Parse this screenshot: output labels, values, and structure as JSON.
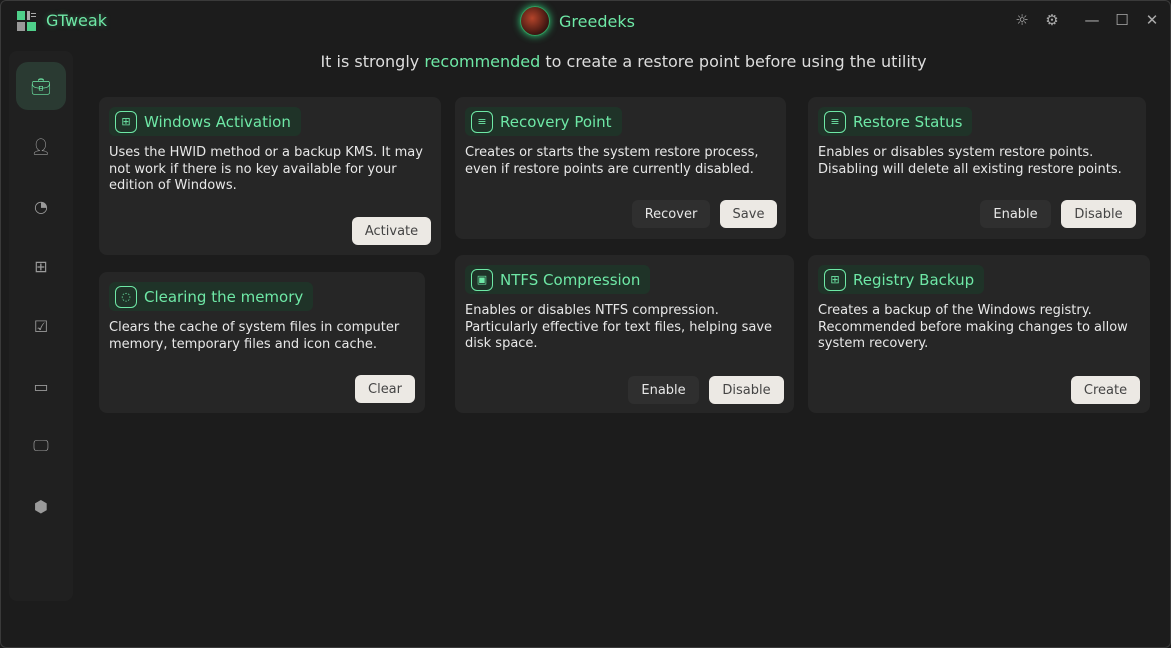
{
  "app": {
    "title": "GTweak",
    "user": "Greedeks"
  },
  "titlebar": {
    "theme_icon": "☼",
    "settings_icon": "⚙",
    "minimize": "—",
    "maximize": "☐",
    "close": "✕"
  },
  "banner": {
    "pre": "It is strongly ",
    "highlight": "recommended",
    "post": " to create a restore point before using the utility"
  },
  "sidebar": [
    "briefcase-icon",
    "user-lock-icon",
    "palette-icon",
    "apps-icon",
    "checklist-icon",
    "drive-icon",
    "monitor-icon",
    "puzzle-icon"
  ],
  "cards": [
    {
      "title": "Windows Activation",
      "desc": "Uses the HWID method or a backup KMS. It may not work if there is no key available for your edition of Windows.",
      "buttons": [
        "Activate"
      ]
    },
    {
      "title": "Recovery Point",
      "desc": "Creates or starts the system restore process, even if restore points are currently disabled.",
      "buttons": [
        "Recover",
        "Save"
      ]
    },
    {
      "title": "Restore Status",
      "desc": "Enables or disables system restore points. Disabling will delete all existing restore points.",
      "buttons": [
        "Enable",
        "Disable"
      ]
    },
    {
      "title": "Clearing the memory",
      "desc": "Clears the cache of system files in computer memory, temporary files and icon cache.",
      "buttons": [
        "Clear"
      ]
    },
    {
      "title": "NTFS Compression",
      "desc": "Enables or disables NTFS compression. Particularly effective for text files, helping save disk space.",
      "buttons": [
        "Enable",
        "Disable"
      ]
    },
    {
      "title": "Registry Backup",
      "desc": "Creates a backup of the Windows registry. Recommended before making changes to allow system recovery.",
      "buttons": [
        "Create"
      ]
    }
  ]
}
